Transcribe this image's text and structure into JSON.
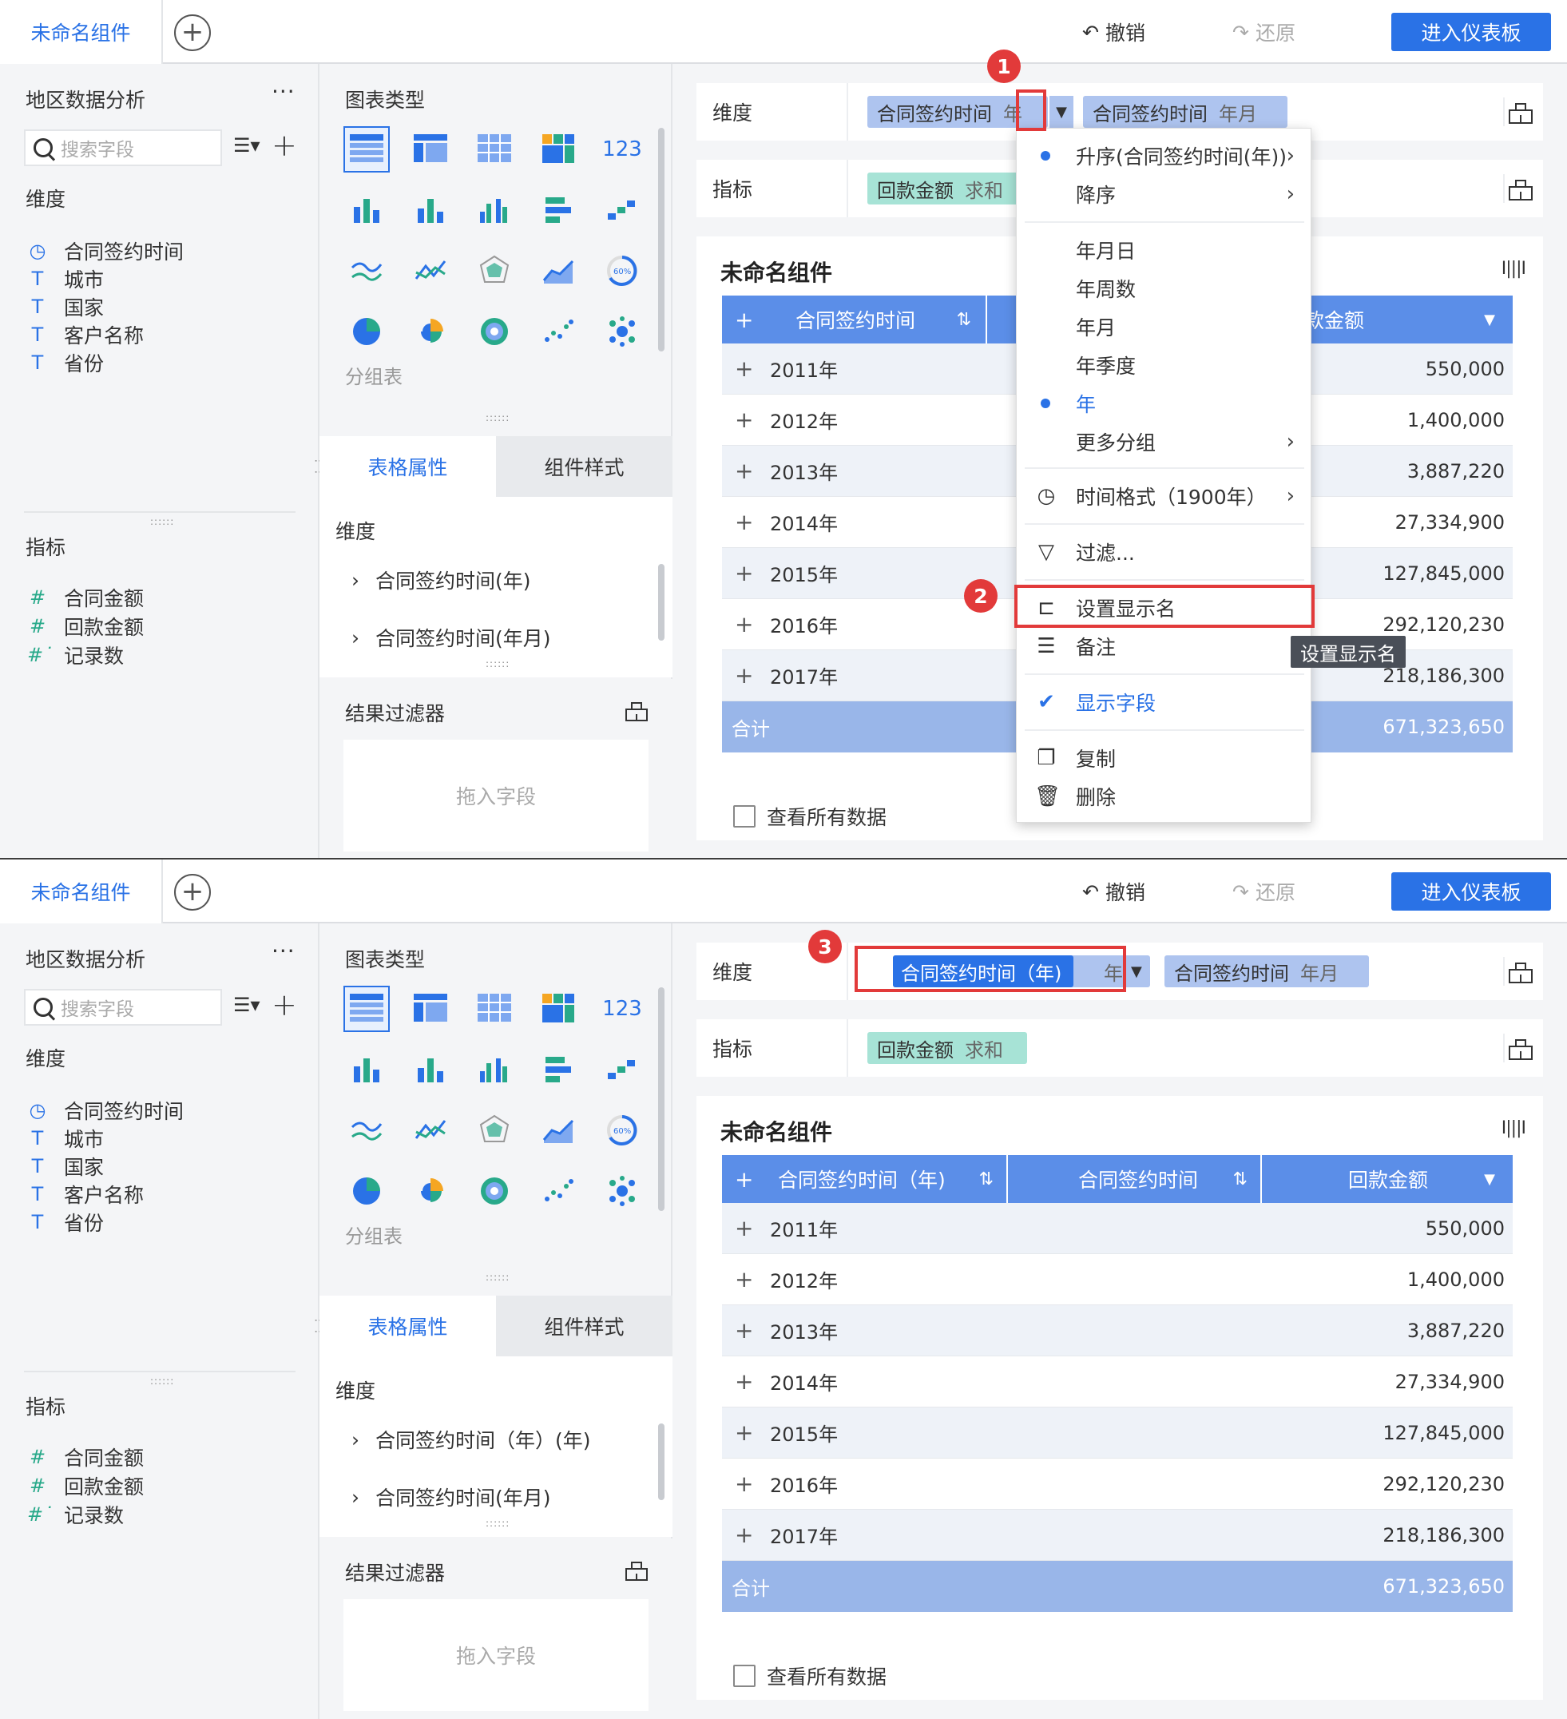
{
  "topbar": {
    "tab": "未命名组件",
    "undo": "撤销",
    "redo": "还原",
    "enter_dashboard": "进入仪表板"
  },
  "left": {
    "dataset": "地区数据分析",
    "more": "···",
    "search_placeholder": "搜索字段",
    "dim_label": "维度",
    "dims": [
      "合同签约时间",
      "城市",
      "国家",
      "客户名称",
      "省份"
    ],
    "mea_label": "指标",
    "measures": [
      "合同金额",
      "回款金额",
      "记录数"
    ]
  },
  "mid": {
    "title": "图表类型",
    "type_label": "分组表",
    "tab_table": "表格属性",
    "tab_style": "组件样式",
    "dim_label": "维度",
    "filter_title": "结果过滤器",
    "drop_text": "拖入字段"
  },
  "screen1": {
    "shelf_dim_label": "维度",
    "shelf_mea_label": "指标",
    "dim_pill1_name": "合同签约时间",
    "dim_pill1_sub": "年",
    "dim_pill2_name": "合同签约时间",
    "dim_pill2_sub": "年月",
    "mea_pill_name": "回款金额",
    "mea_pill_sub": "求和",
    "widget_title": "未命名组件",
    "prop_items": [
      "合同签约时间(年)",
      "合同签约时间(年月)"
    ],
    "col1": "合同签约时间",
    "col3": "回款金额",
    "view_all": "查看所有数据"
  },
  "screen2": {
    "dim_pill1_name": "合同签约时间（年)",
    "dim_pill1_sub": "年",
    "dim_pill2_name": "合同签约时间",
    "dim_pill2_sub": "年月",
    "mea_pill_name": "回款金额",
    "mea_pill_sub": "求和",
    "widget_title": "未命名组件",
    "prop_items": [
      "合同签约时间（年）(年)",
      "合同签约时间(年月)"
    ],
    "col1": "合同签约时间（年)",
    "col2": "合同签约时间",
    "col3": "回款金额",
    "view_all": "查看所有数据"
  },
  "table": {
    "rows": [
      {
        "label": "2011年",
        "value": "550,000"
      },
      {
        "label": "2012年",
        "value": "1,400,000"
      },
      {
        "label": "2013年",
        "value": "3,887,220"
      },
      {
        "label": "2014年",
        "value": "27,334,900"
      },
      {
        "label": "2015年",
        "value": "127,845,000"
      },
      {
        "label": "2016年",
        "value": "292,120,230"
      },
      {
        "label": "2017年",
        "value": "218,186,300"
      }
    ],
    "total_label": "合计",
    "total_value": "671,323,650"
  },
  "menu": {
    "asc": "升序(合同签约时间(年))",
    "desc": "降序",
    "ymd": "年月日",
    "yw": "年周数",
    "ym": "年月",
    "yq": "年季度",
    "y": "年",
    "more": "更多分组",
    "timefmt": "时间格式（1900年）",
    "filter": "过滤...",
    "rename": "设置显示名",
    "note": "备注",
    "show": "显示字段",
    "copy": "复制",
    "delete": "删除"
  },
  "tooltip": "设置显示名",
  "badges": [
    "1",
    "2",
    "3"
  ],
  "colors": {
    "accent": "#2a72e6",
    "header": "#5b8ee8",
    "total": "#99b6e9",
    "highlight": "#e23a3a",
    "dim_pill": "#aec4ef",
    "mea_pill": "#a7e3d6"
  }
}
